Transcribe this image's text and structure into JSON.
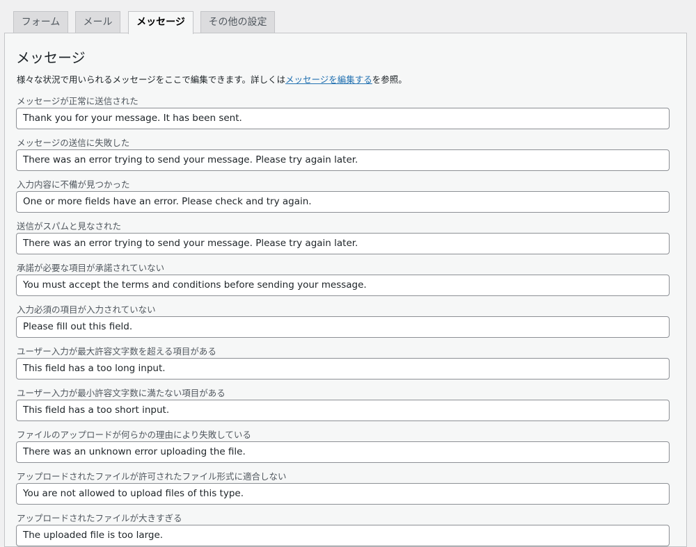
{
  "tabs": [
    {
      "label": "フォーム"
    },
    {
      "label": "メール"
    },
    {
      "label": "メッセージ"
    },
    {
      "label": "その他の設定"
    }
  ],
  "section": {
    "title": "メッセージ",
    "description_before": "様々な状況で用いられるメッセージをここで編集できます。詳しくは",
    "description_link": "メッセージを編集する",
    "description_after": "を参照。"
  },
  "fields": [
    {
      "label": "メッセージが正常に送信された",
      "value": "Thank you for your message. It has been sent."
    },
    {
      "label": "メッセージの送信に失敗した",
      "value": "There was an error trying to send your message. Please try again later."
    },
    {
      "label": "入力内容に不備が見つかった",
      "value": "One or more fields have an error. Please check and try again."
    },
    {
      "label": "送信がスパムと見なされた",
      "value": "There was an error trying to send your message. Please try again later."
    },
    {
      "label": "承諾が必要な項目が承諾されていない",
      "value": "You must accept the terms and conditions before sending your message."
    },
    {
      "label": "入力必須の項目が入力されていない",
      "value": "Please fill out this field."
    },
    {
      "label": "ユーザー入力が最大許容文字数を超える項目がある",
      "value": "This field has a too long input."
    },
    {
      "label": "ユーザー入力が最小許容文字数に満たない項目がある",
      "value": "This field has a too short input."
    },
    {
      "label": "ファイルのアップロードが何らかの理由により失敗している",
      "value": "There was an unknown error uploading the file."
    },
    {
      "label": "アップロードされたファイルが許可されたファイル形式に適合しない",
      "value": "You are not allowed to upload files of this type."
    },
    {
      "label": "アップロードされたファイルが大きすぎる",
      "value": "The uploaded file is too large."
    }
  ]
}
